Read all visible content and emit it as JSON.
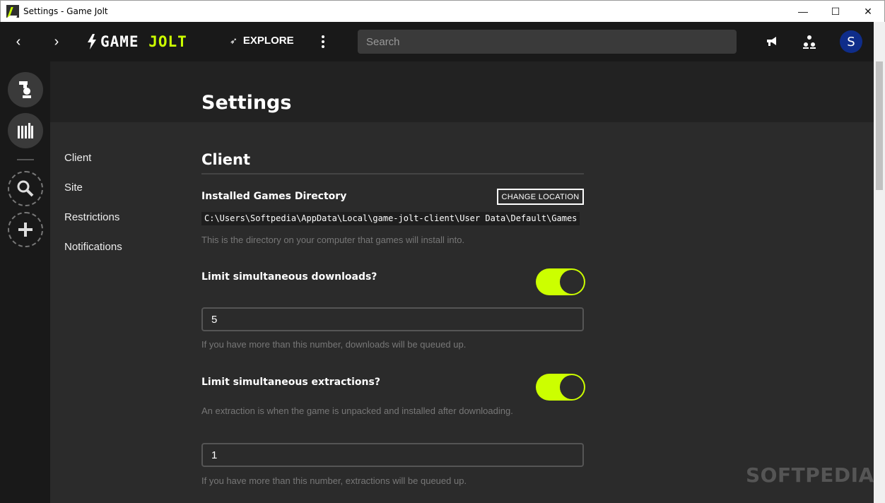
{
  "window": {
    "title": "Settings - Game Jolt",
    "minimize_glyph": "—",
    "maximize_glyph": "☐",
    "close_glyph": "✕"
  },
  "topbar": {
    "back_glyph": "‹",
    "forward_glyph": "›",
    "logo_game": "GAME",
    "logo_jolt": "JOLT",
    "explore_label": "EXPLORE",
    "search_placeholder": "Search",
    "avatar_initial": "S"
  },
  "page": {
    "title": "Settings"
  },
  "side_nav": {
    "items": [
      {
        "label": "Client"
      },
      {
        "label": "Site"
      },
      {
        "label": "Restrictions"
      },
      {
        "label": "Notifications"
      }
    ]
  },
  "client": {
    "section_title": "Client",
    "games_dir_label": "Installed Games Directory",
    "change_location_label": "CHANGE LOCATION",
    "games_dir_path": "C:\\Users\\Softpedia\\AppData\\Local\\game-jolt-client\\User Data\\Default\\Games",
    "games_dir_help": "This is the directory on your computer that games will install into.",
    "limit_downloads_label": "Limit simultaneous downloads?",
    "limit_downloads_value": "5",
    "limit_downloads_help": "If you have more than this number, downloads will be queued up.",
    "limit_extractions_label": "Limit simultaneous extractions?",
    "limit_extractions_help_top": "An extraction is when the game is unpacked and installed after downloading.",
    "limit_extractions_value": "1",
    "limit_extractions_help": "If you have more than this number, extractions will be queued up."
  },
  "watermark": "SOFTPEDIA",
  "colors": {
    "accent": "#ccff00",
    "shell_bg": "#191919",
    "page_bg": "#2b2b2b",
    "avatar_bg": "#0f2d8a"
  }
}
